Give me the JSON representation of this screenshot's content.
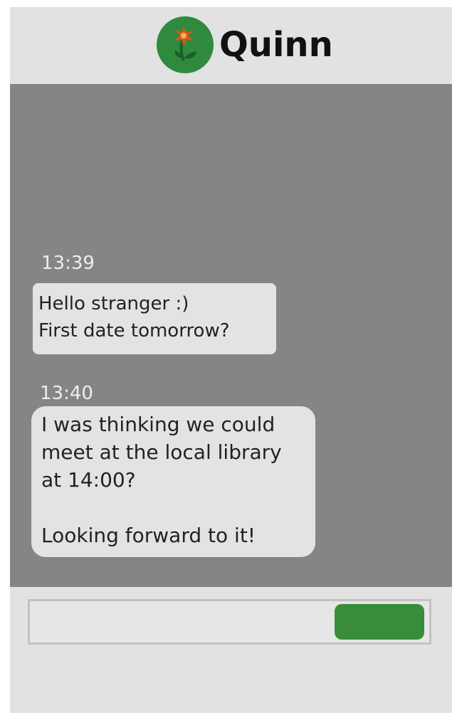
{
  "header": {
    "contact_name": "Quinn",
    "avatar_icon": "flower-icon"
  },
  "messages": [
    {
      "time": "13:39",
      "lines": [
        "Hello stranger :)",
        "First date tomorrow?"
      ]
    },
    {
      "time": "13:40",
      "lines": [
        "I was thinking we could",
        "meet at the local library",
        "at 14:00?",
        "",
        "Looking forward to it!"
      ]
    }
  ],
  "composer": {
    "input_value": "",
    "send_label": ""
  },
  "colors": {
    "frame_background": "#e2e2e2",
    "chat_background": "#858585",
    "bubble_background": "#e3e3e3",
    "avatar_green": "#2f8a3e",
    "send_button_green": "#388c3a",
    "flower_orange": "#c95a22"
  }
}
